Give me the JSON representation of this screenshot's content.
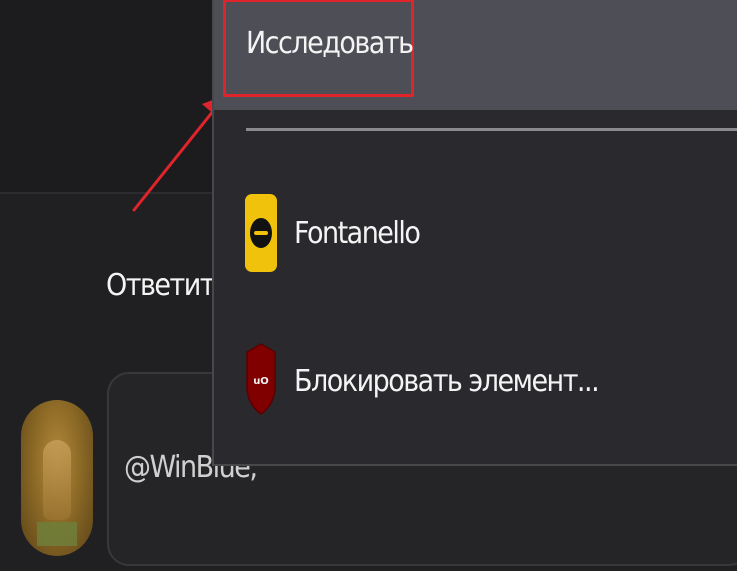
{
  "page": {
    "reply_link": "Ответить",
    "comment_mention": "@WinBlue,"
  },
  "context_menu": {
    "inspect_label": "Исследовать",
    "items": [
      {
        "label": "Fontanello",
        "icon": "fontanello-icon"
      },
      {
        "label": "Блокировать элемент...",
        "icon": "ublock-icon"
      }
    ]
  },
  "annotation": {
    "highlight_color": "#e0242b",
    "target": "Исследовать"
  },
  "colors": {
    "menu_background": "#29292e",
    "hovered_item": "#4e4e56",
    "fontanello_yellow": "#f0c20c",
    "ublock_red": "#800000"
  }
}
